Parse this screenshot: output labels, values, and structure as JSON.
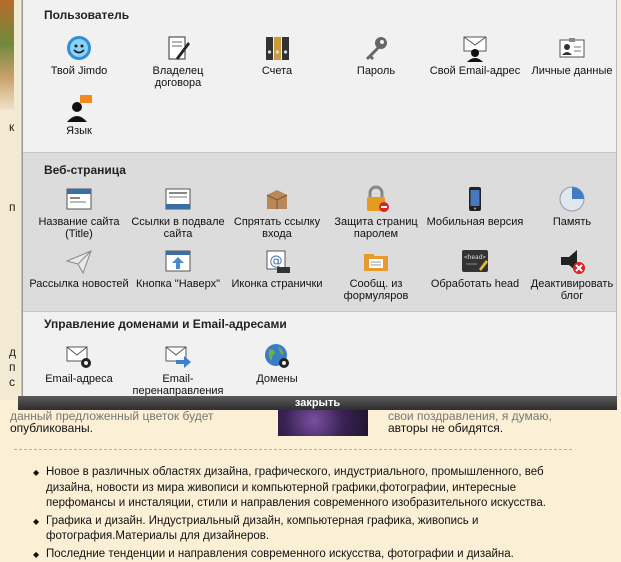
{
  "background": {
    "left_letters": [
      "к",
      "п",
      "д",
      "п",
      "с",
      "Д"
    ],
    "text_left": "опубликованы.",
    "text_left_partial": "данный предложенный цветок будет",
    "text_right_1": "свои поздравления, я думаю,",
    "text_right_2": "авторы не обидятся.",
    "bullets": [
      "Новое в различных областях дизайна, графического, индустриального, промышленного, веб дизайна, новости из мира живописи и компьютерной графики,фотографии, интересные перфомансы и инсталяции, стили и направления современного изобразительного искусства.",
      "Графика и дизайн. Индустриальный дизайн, компьютерная графика, живопись и фотография.Материалы для дизайнеров.",
      "Последние тенденции и направления современного искусства, фотографии и дизайна."
    ]
  },
  "modal": {
    "sections": [
      {
        "title": "Пользователь",
        "items": [
          {
            "label": "Твой Jimdo",
            "icon": "jimdo-smiley-icon"
          },
          {
            "label": "Владелец договора",
            "icon": "contract-owner-icon"
          },
          {
            "label": "Счета",
            "icon": "invoice-binders-icon"
          },
          {
            "label": "Пароль",
            "icon": "key-icon"
          },
          {
            "label": "Свой Email-адрес",
            "icon": "user-email-icon"
          },
          {
            "label": "Личные данные",
            "icon": "id-card-icon"
          },
          {
            "label": "Язык",
            "icon": "language-user-icon"
          }
        ]
      },
      {
        "title": "Веб-страница",
        "items": [
          {
            "label": "Название сайта (Title)",
            "icon": "site-title-icon"
          },
          {
            "label": "Ссылки в подвале сайта",
            "icon": "footer-links-icon"
          },
          {
            "label": "Спрятать ссылку входа",
            "icon": "hide-login-icon"
          },
          {
            "label": "Защита страниц паролем",
            "icon": "lock-icon"
          },
          {
            "label": "Мобильная версия",
            "icon": "mobile-phone-icon"
          },
          {
            "label": "Память",
            "icon": "storage-pie-icon"
          },
          {
            "label": "Рассылка новостей",
            "icon": "paper-plane-icon"
          },
          {
            "label": "Кнопка \"Наверх\"",
            "icon": "back-to-top-icon"
          },
          {
            "label": "Иконка странички",
            "icon": "favicon-icon"
          },
          {
            "label": "Сообщ. из формуляров",
            "icon": "form-folder-icon"
          },
          {
            "label": "Обработать head",
            "icon": "head-code-icon"
          },
          {
            "label": "Деактивировать блог",
            "icon": "deactivate-blog-icon"
          }
        ]
      },
      {
        "title": "Управление доменами и Email-адресами",
        "items": [
          {
            "label": "Email-адреса",
            "icon": "email-settings-icon"
          },
          {
            "label": "Email-перенаправления",
            "icon": "email-forward-icon"
          },
          {
            "label": "Домены",
            "icon": "domain-globe-icon"
          }
        ]
      }
    ],
    "close_label": "закрыть"
  }
}
